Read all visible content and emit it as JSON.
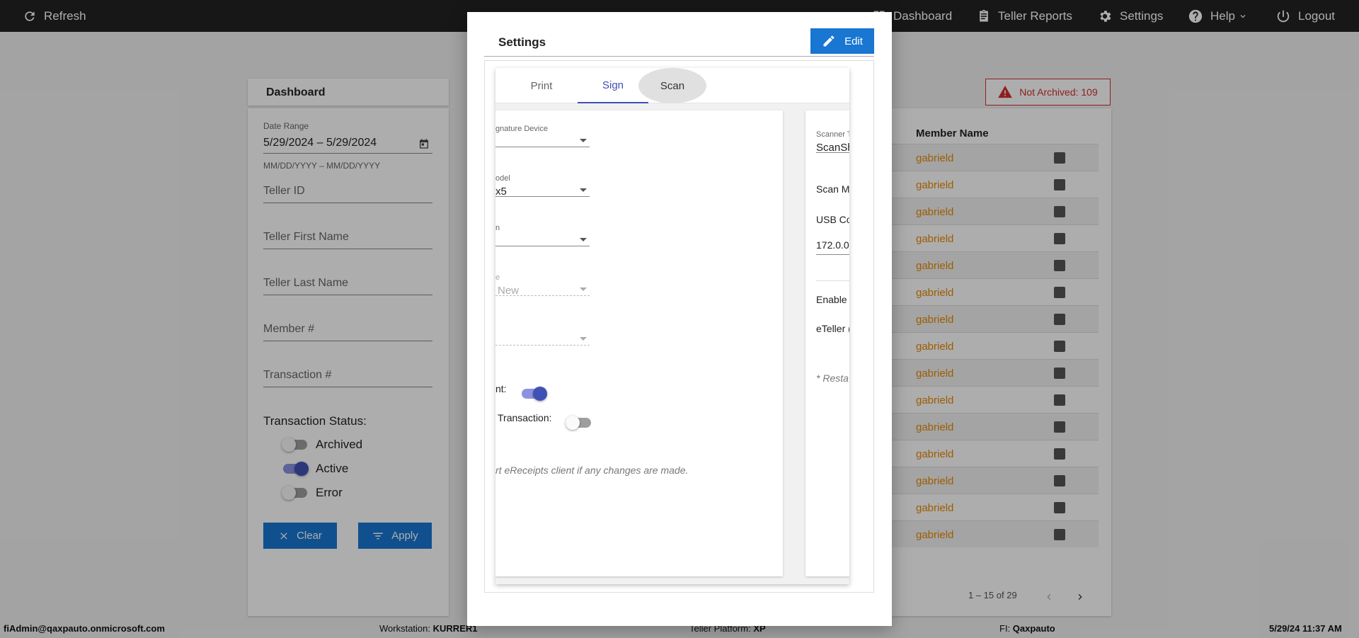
{
  "topbar": {
    "refresh": "Refresh",
    "dashboard": "Dashboard",
    "teller_reports": "Teller Reports",
    "settings": "Settings",
    "help": "Help",
    "logout": "Logout"
  },
  "dashboard": {
    "title": "Dashboard",
    "date_range_label": "Date Range",
    "date_range_value": "5/29/2024 – 5/29/2024",
    "date_format_hint": "MM/DD/YYYY – MM/DD/YYYY",
    "teller_id": "Teller ID",
    "teller_first_name": "Teller First Name",
    "teller_last_name": "Teller Last Name",
    "member_no": "Member #",
    "transaction_no": "Transaction #",
    "status_title": "Transaction Status:",
    "status": [
      {
        "label": "Archived",
        "on": false
      },
      {
        "label": "Active",
        "on": true
      },
      {
        "label": "Error",
        "on": false
      }
    ],
    "clear": "Clear",
    "apply": "Apply"
  },
  "banner": {
    "text": "Not Archived: 109",
    "color": "#d32f2f"
  },
  "table": {
    "header_member_name": "Member Name",
    "rows": [
      "gabrield",
      "gabrield",
      "gabrield",
      "gabrield",
      "gabrield",
      "gabrield",
      "gabrield",
      "gabrield",
      "gabrield",
      "gabrield",
      "gabrield",
      "gabrield",
      "gabrield",
      "gabrield",
      "gabrield"
    ],
    "pager": "1 – 15 of 29"
  },
  "footer": {
    "user": "fiAdmin@qaxpauto.onmicrosoft.com",
    "workstation_label": "Workstation:",
    "workstation": "KURRER1",
    "platform_label": "Teller Platform:",
    "platform": "XP",
    "fi_label": "FI:",
    "fi": "Qaxpauto",
    "datetime": "5/29/24 11:37 AM"
  },
  "modal": {
    "title": "Settings",
    "edit": "Edit",
    "tabs": [
      "Print",
      "Sign",
      "Scan"
    ],
    "active_tab": "Sign",
    "sign_panel": {
      "signature_device_label": "gnature Device",
      "model_label": "odel",
      "model_value": "x5",
      "field3_label": "n",
      "field4_label": "e",
      "field4_value": "New",
      "toggle1_label": "nt:",
      "toggle1_on": true,
      "toggle2_label": "Transaction:",
      "toggle2_on": false,
      "note": "rt eReceipts client if any changes are made."
    },
    "scan_panel": {
      "scanner_type_label": "Scanner T",
      "scanner_type_value": "ScanSh",
      "scan_mode": "Scan M",
      "usb": "USB Co",
      "ip": "172.0.0",
      "enable": "Enable",
      "eteller": "eTeller (",
      "note": "* Resta"
    }
  },
  "colors": {
    "accent": "#1976d2",
    "toggle_on": "#3f51b5",
    "member_name": "#e68a00"
  }
}
